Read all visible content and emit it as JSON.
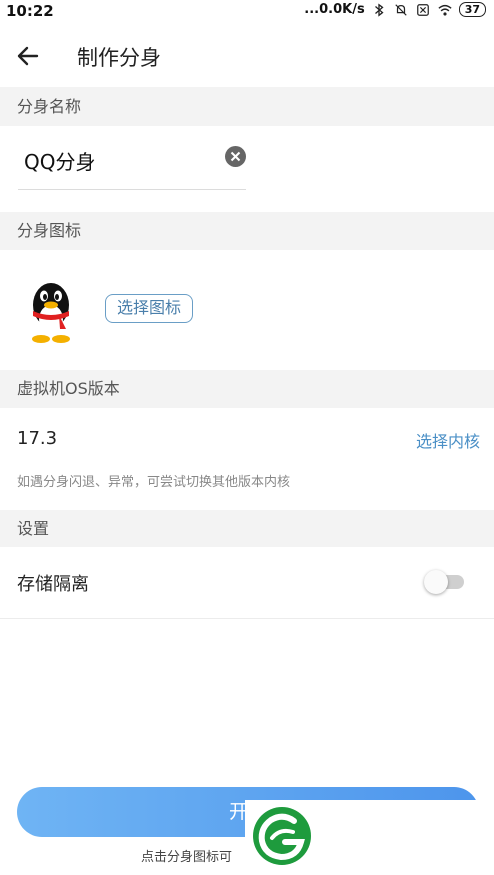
{
  "status_bar": {
    "time": "10:22",
    "network_speed": "...0.0K/s",
    "battery": "37",
    "icons": [
      "bluetooth-icon",
      "mute-icon",
      "sim-off-icon",
      "wifi-icon",
      "battery-icon"
    ]
  },
  "app_bar": {
    "title": "制作分身",
    "back_icon": "arrow-left-icon"
  },
  "sections": {
    "name": {
      "header": "分身名称",
      "value": "QQ分身"
    },
    "icon": {
      "header": "分身图标",
      "choose_label": "选择图标"
    },
    "os": {
      "header": "虚拟机OS版本",
      "version": "17.3",
      "choose_label": "选择内核",
      "hint": "如遇分身闪退、异常，可尝试切换其他版本内核"
    },
    "settings": {
      "header": "设置",
      "storage_label": "存储隔离",
      "storage_isolation_on": false
    }
  },
  "footer": {
    "start_label": "开始",
    "hint": "点击分身图标可"
  },
  "colors": {
    "accent": "#4a8fc6",
    "button_start": "#6fb4f4",
    "button_end": "#4d95ec",
    "logo_green": "#1e9b3d"
  }
}
